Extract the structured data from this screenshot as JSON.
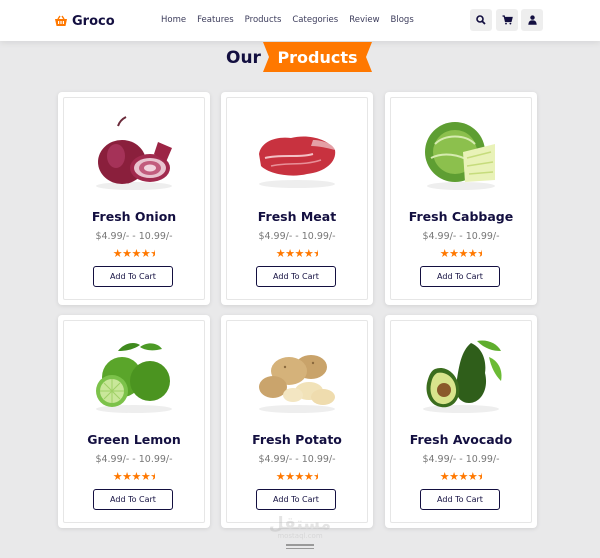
{
  "header": {
    "logo_text": "Groco",
    "nav": [
      "Home",
      "Features",
      "Products",
      "Categories",
      "Review",
      "Blogs"
    ],
    "icons": [
      "search-icon",
      "cart-icon",
      "user-icon"
    ]
  },
  "section": {
    "title_prefix": "Our",
    "title_highlight": "Products"
  },
  "theme": {
    "accent": "#ff7800",
    "dark": "#130f40"
  },
  "products": [
    {
      "name": "Fresh Onion",
      "price": "$4.99/- - 10.99/-",
      "rating": 4.5,
      "button": "Add To Cart"
    },
    {
      "name": "Fresh Meat",
      "price": "$4.99/- - 10.99/-",
      "rating": 4.5,
      "button": "Add To Cart"
    },
    {
      "name": "Fresh Cabbage",
      "price": "$4.99/- - 10.99/-",
      "rating": 4.5,
      "button": "Add To Cart"
    },
    {
      "name": "Green Lemon",
      "price": "$4.99/- - 10.99/-",
      "rating": 4.5,
      "button": "Add To Cart"
    },
    {
      "name": "Fresh Potato",
      "price": "$4.99/- - 10.99/-",
      "rating": 4.5,
      "button": "Add To Cart"
    },
    {
      "name": "Fresh Avocado",
      "price": "$4.99/- - 10.99/-",
      "rating": 4.5,
      "button": "Add To Cart"
    }
  ],
  "watermark": {
    "arabic": "مستقل",
    "latin": "mostaql.com"
  }
}
